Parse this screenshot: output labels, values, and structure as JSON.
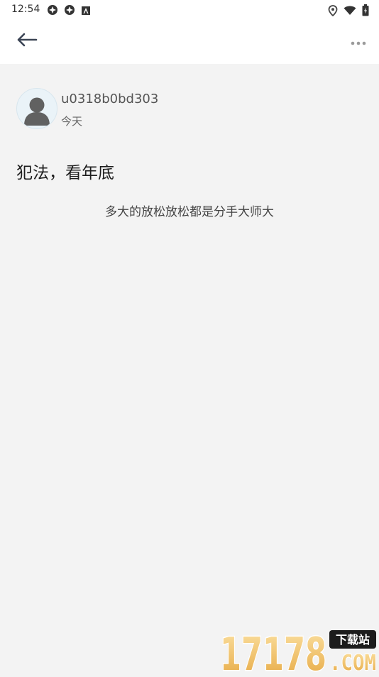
{
  "status_bar": {
    "time": "12:54"
  },
  "icons": {
    "back": "arrow-left-icon",
    "more": "more-horizontal-icon",
    "avatar": "user-avatar-icon",
    "status_left": [
      "app-notification-icon",
      "app-notification-icon",
      "android-notification-icon"
    ],
    "status_right": [
      "location-icon",
      "wifi-icon",
      "battery-icon"
    ]
  },
  "post": {
    "author": "u0318b0bd303",
    "date": "今天",
    "title": "犯法，看年底",
    "body": "多大的放松放松都是分手大师大"
  },
  "watermark": {
    "number": "17178",
    "download": "下载站",
    "domain": ".COM"
  },
  "colors": {
    "background": "#f3f3f3",
    "app_bar": "#ffffff",
    "watermark_gold": "#f3c46c",
    "watermark_dark": "#1c1c1c"
  }
}
